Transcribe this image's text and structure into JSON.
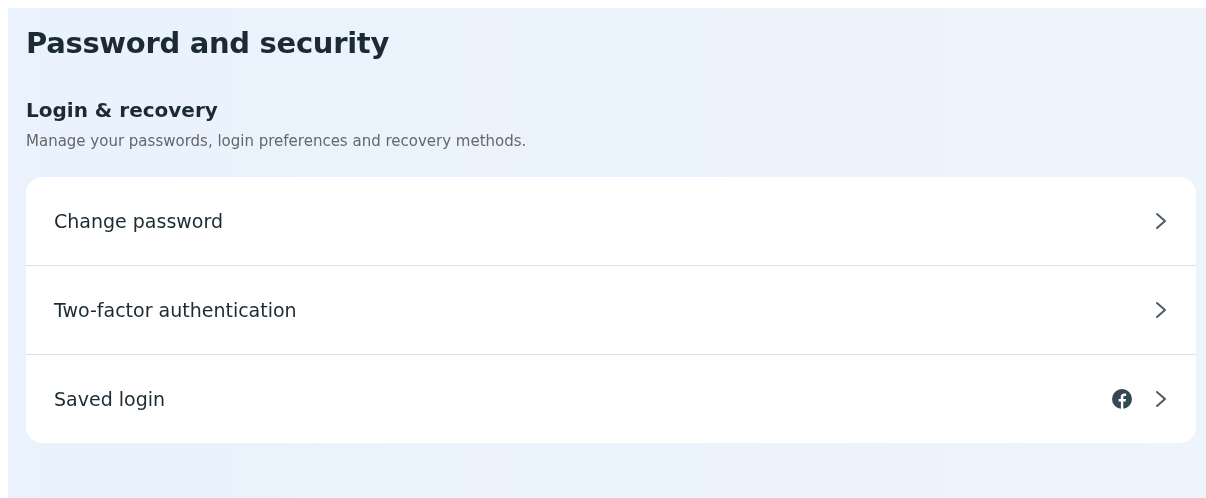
{
  "title": "Password and security",
  "section": {
    "heading": "Login & recovery",
    "description": "Manage your passwords, login preferences and recovery methods."
  },
  "items": [
    {
      "label": "Change password",
      "kind": "plain"
    },
    {
      "label": "Two-factor authentication",
      "kind": "plain"
    },
    {
      "label": "Saved login",
      "kind": "account"
    }
  ]
}
